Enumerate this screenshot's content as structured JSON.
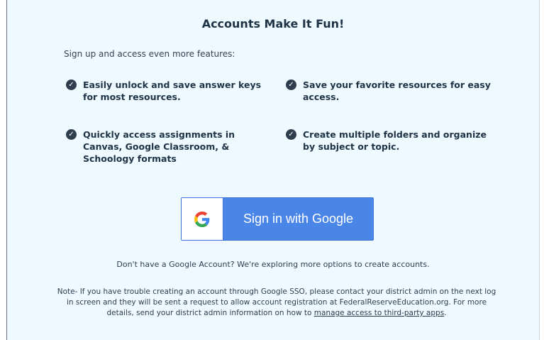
{
  "panel": {
    "title": "Accounts Make It Fun!",
    "intro": "Sign up and access even more features:",
    "features": [
      {
        "text": "Easily unlock and save answer keys for most resources.",
        "icon": "check-circle-icon"
      },
      {
        "text": "Save your favorite resources for easy access.",
        "icon": "check-circle-icon"
      },
      {
        "text": "Quickly access assignments in Canvas, Google Classroom, & Schoology formats",
        "icon": "check-circle-icon"
      },
      {
        "text": "Create multiple folders and organize by subject or topic.",
        "icon": "check-circle-icon"
      }
    ],
    "google_button": {
      "label": "Sign in with Google",
      "icon": "google-g-icon"
    },
    "no_account_text": "Don't have a Google Account? We're exploring more options to create accounts.",
    "note_text": "Note- If you have trouble creating an account through Google SSO, please contact your district admin on the next log in screen and they will be sent a request to allow account registration at FederalReserveEducation.org. For more details, send your district admin information on how to ",
    "note_link": "manage access to third-party apps",
    "note_end": "."
  },
  "colors": {
    "panel_bg": "#eefaff",
    "button_blue": "#4a86e8",
    "text_dark": "#1f3347"
  }
}
